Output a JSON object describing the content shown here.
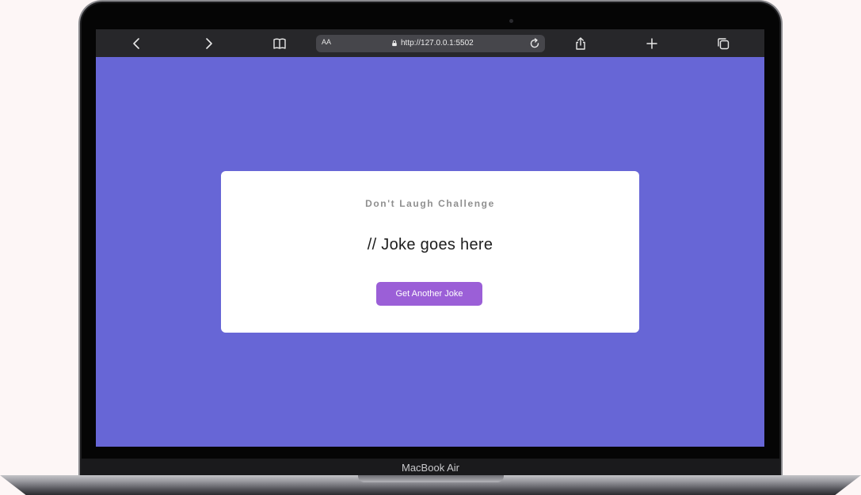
{
  "device": {
    "model_label": "MacBook Air"
  },
  "browser": {
    "text_size_label": "AA",
    "url": "http://127.0.0.1:5502",
    "icons": [
      "back-icon",
      "forward-icon",
      "bookmarks-icon",
      "lock-icon",
      "reload-icon",
      "share-icon",
      "new-tab-icon",
      "tabs-icon"
    ]
  },
  "page": {
    "background_color": "#6766d6",
    "card": {
      "title": "Don't Laugh Challenge",
      "joke": "// Joke goes here",
      "button_label": "Get Another Joke",
      "button_color": "#9b5fd7"
    }
  }
}
